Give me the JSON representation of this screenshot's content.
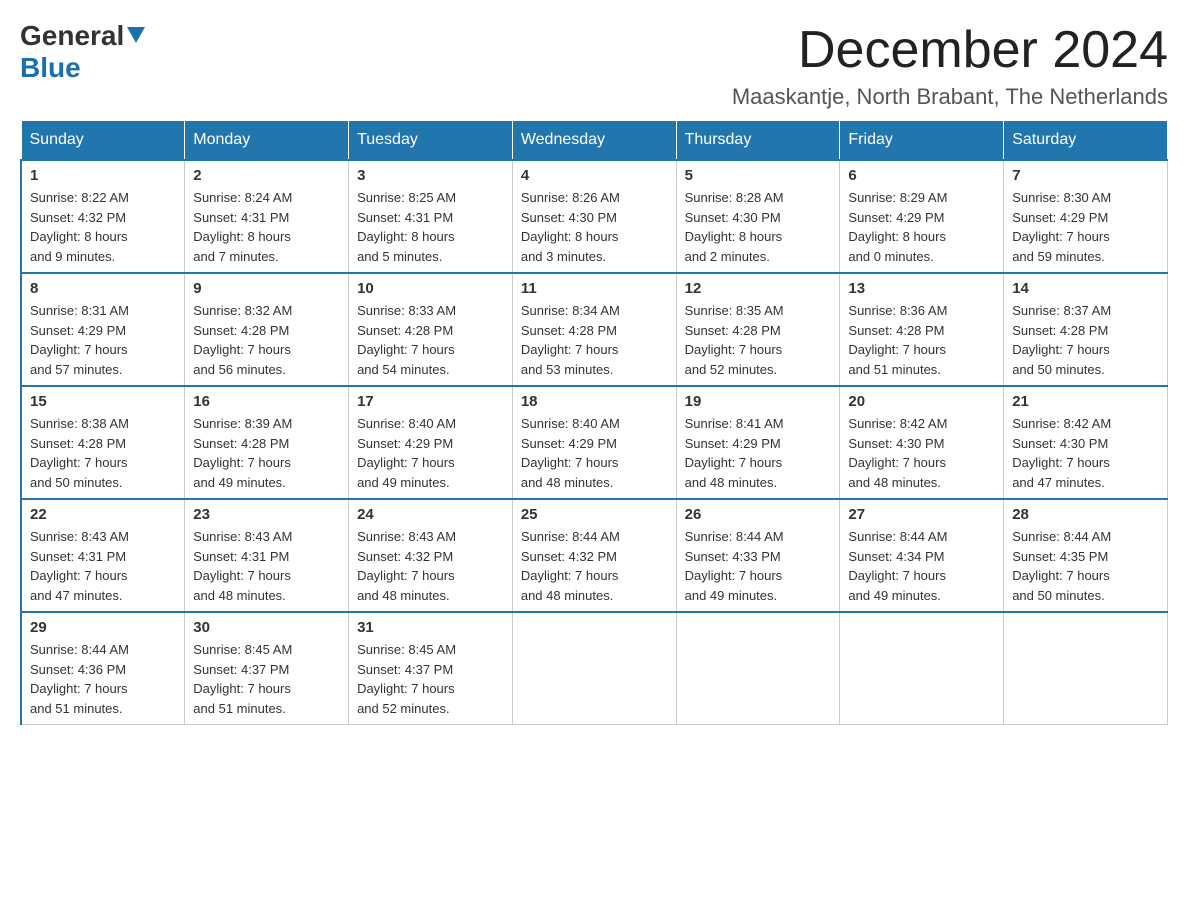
{
  "logo": {
    "general": "General",
    "blue": "Blue"
  },
  "title": "December 2024",
  "location": "Maaskantje, North Brabant, The Netherlands",
  "days_of_week": [
    "Sunday",
    "Monday",
    "Tuesday",
    "Wednesday",
    "Thursday",
    "Friday",
    "Saturday"
  ],
  "weeks": [
    [
      {
        "day": "1",
        "sunrise": "8:22 AM",
        "sunset": "4:32 PM",
        "daylight": "8 hours and 9 minutes."
      },
      {
        "day": "2",
        "sunrise": "8:24 AM",
        "sunset": "4:31 PM",
        "daylight": "8 hours and 7 minutes."
      },
      {
        "day": "3",
        "sunrise": "8:25 AM",
        "sunset": "4:31 PM",
        "daylight": "8 hours and 5 minutes."
      },
      {
        "day": "4",
        "sunrise": "8:26 AM",
        "sunset": "4:30 PM",
        "daylight": "8 hours and 3 minutes."
      },
      {
        "day": "5",
        "sunrise": "8:28 AM",
        "sunset": "4:30 PM",
        "daylight": "8 hours and 2 minutes."
      },
      {
        "day": "6",
        "sunrise": "8:29 AM",
        "sunset": "4:29 PM",
        "daylight": "8 hours and 0 minutes."
      },
      {
        "day": "7",
        "sunrise": "8:30 AM",
        "sunset": "4:29 PM",
        "daylight": "7 hours and 59 minutes."
      }
    ],
    [
      {
        "day": "8",
        "sunrise": "8:31 AM",
        "sunset": "4:29 PM",
        "daylight": "7 hours and 57 minutes."
      },
      {
        "day": "9",
        "sunrise": "8:32 AM",
        "sunset": "4:28 PM",
        "daylight": "7 hours and 56 minutes."
      },
      {
        "day": "10",
        "sunrise": "8:33 AM",
        "sunset": "4:28 PM",
        "daylight": "7 hours and 54 minutes."
      },
      {
        "day": "11",
        "sunrise": "8:34 AM",
        "sunset": "4:28 PM",
        "daylight": "7 hours and 53 minutes."
      },
      {
        "day": "12",
        "sunrise": "8:35 AM",
        "sunset": "4:28 PM",
        "daylight": "7 hours and 52 minutes."
      },
      {
        "day": "13",
        "sunrise": "8:36 AM",
        "sunset": "4:28 PM",
        "daylight": "7 hours and 51 minutes."
      },
      {
        "day": "14",
        "sunrise": "8:37 AM",
        "sunset": "4:28 PM",
        "daylight": "7 hours and 50 minutes."
      }
    ],
    [
      {
        "day": "15",
        "sunrise": "8:38 AM",
        "sunset": "4:28 PM",
        "daylight": "7 hours and 50 minutes."
      },
      {
        "day": "16",
        "sunrise": "8:39 AM",
        "sunset": "4:28 PM",
        "daylight": "7 hours and 49 minutes."
      },
      {
        "day": "17",
        "sunrise": "8:40 AM",
        "sunset": "4:29 PM",
        "daylight": "7 hours and 49 minutes."
      },
      {
        "day": "18",
        "sunrise": "8:40 AM",
        "sunset": "4:29 PM",
        "daylight": "7 hours and 48 minutes."
      },
      {
        "day": "19",
        "sunrise": "8:41 AM",
        "sunset": "4:29 PM",
        "daylight": "7 hours and 48 minutes."
      },
      {
        "day": "20",
        "sunrise": "8:42 AM",
        "sunset": "4:30 PM",
        "daylight": "7 hours and 48 minutes."
      },
      {
        "day": "21",
        "sunrise": "8:42 AM",
        "sunset": "4:30 PM",
        "daylight": "7 hours and 47 minutes."
      }
    ],
    [
      {
        "day": "22",
        "sunrise": "8:43 AM",
        "sunset": "4:31 PM",
        "daylight": "7 hours and 47 minutes."
      },
      {
        "day": "23",
        "sunrise": "8:43 AM",
        "sunset": "4:31 PM",
        "daylight": "7 hours and 48 minutes."
      },
      {
        "day": "24",
        "sunrise": "8:43 AM",
        "sunset": "4:32 PM",
        "daylight": "7 hours and 48 minutes."
      },
      {
        "day": "25",
        "sunrise": "8:44 AM",
        "sunset": "4:32 PM",
        "daylight": "7 hours and 48 minutes."
      },
      {
        "day": "26",
        "sunrise": "8:44 AM",
        "sunset": "4:33 PM",
        "daylight": "7 hours and 49 minutes."
      },
      {
        "day": "27",
        "sunrise": "8:44 AM",
        "sunset": "4:34 PM",
        "daylight": "7 hours and 49 minutes."
      },
      {
        "day": "28",
        "sunrise": "8:44 AM",
        "sunset": "4:35 PM",
        "daylight": "7 hours and 50 minutes."
      }
    ],
    [
      {
        "day": "29",
        "sunrise": "8:44 AM",
        "sunset": "4:36 PM",
        "daylight": "7 hours and 51 minutes."
      },
      {
        "day": "30",
        "sunrise": "8:45 AM",
        "sunset": "4:37 PM",
        "daylight": "7 hours and 51 minutes."
      },
      {
        "day": "31",
        "sunrise": "8:45 AM",
        "sunset": "4:37 PM",
        "daylight": "7 hours and 52 minutes."
      },
      null,
      null,
      null,
      null
    ]
  ]
}
